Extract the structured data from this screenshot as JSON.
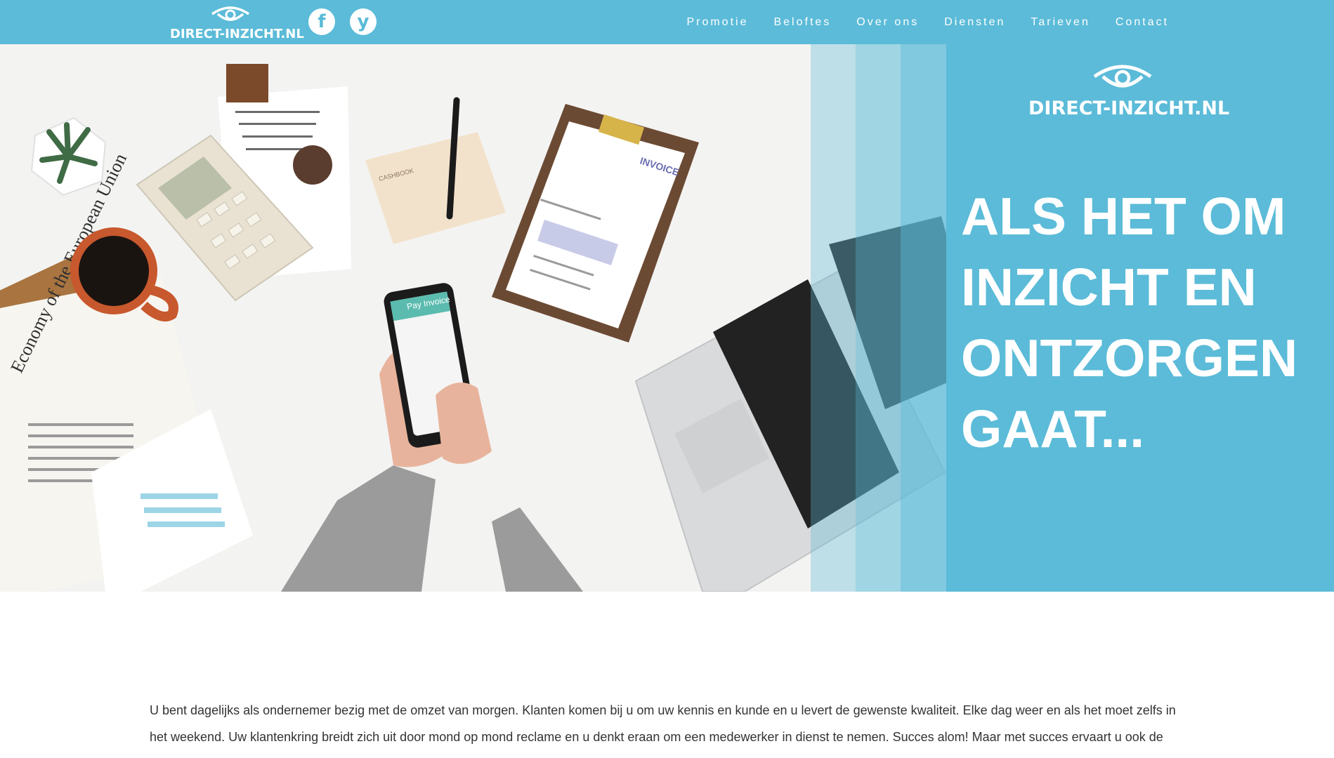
{
  "header": {
    "logo_text": "DIRECT-INZICHT.NL",
    "social": [
      {
        "name": "facebook",
        "glyph": "f"
      },
      {
        "name": "yelp",
        "glyph": "y"
      }
    ],
    "nav": [
      "Promotie",
      "Beloftes",
      "Over ons",
      "Diensten",
      "Tarieven",
      "Contact"
    ]
  },
  "hero": {
    "logo_text": "DIRECT-INZICHT.NL",
    "headline_lines": [
      "ALS HET OM",
      "INZICHT EN",
      "ONTZORGEN",
      "GAAT..."
    ],
    "phone_screen_title": "Pay Invoice",
    "newspaper_heading": "Economy of the European Union",
    "invoice_heading": "INVOICE",
    "cashbook_label": "CASHBOOK"
  },
  "intro": {
    "text": "U bent dagelijks als ondernemer bezig met de omzet van morgen. Klanten komen bij u om uw kennis en kunde en u levert de gewenste kwaliteit. Elke dag weer en als het moet zelfs in het weekend. Uw klantenkring breidt zich uit door mond op mond reclame en u denkt eraan om een medewerker in dienst te nemen. Succes alom! Maar met succes ervaart u ook de"
  },
  "colors": {
    "brand": "#5bbbd8",
    "text": "#333333",
    "white": "#ffffff"
  }
}
